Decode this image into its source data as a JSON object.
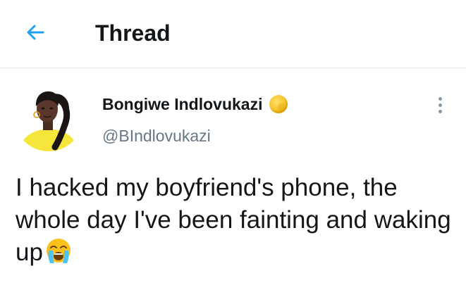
{
  "header": {
    "title": "Thread",
    "back_icon": "arrow-left-icon",
    "accent_color": "#1da1f2"
  },
  "tweet": {
    "author": {
      "display_name": "Bongiwe Indlovukazi",
      "handle": "@BIndlovukazi",
      "name_emoji": "gold-circle-emoji",
      "avatar": "profile-photo-avatar"
    },
    "text": "I hacked my boyfriend's phone, the whole day I've been fainting and waking up",
    "trailing_emoji": "loudly-crying-face-emoji",
    "more_icon": "more-vertical-icon"
  },
  "colors": {
    "text_primary": "#14171a",
    "text_secondary": "#657786",
    "divider": "#e1e8ed"
  }
}
